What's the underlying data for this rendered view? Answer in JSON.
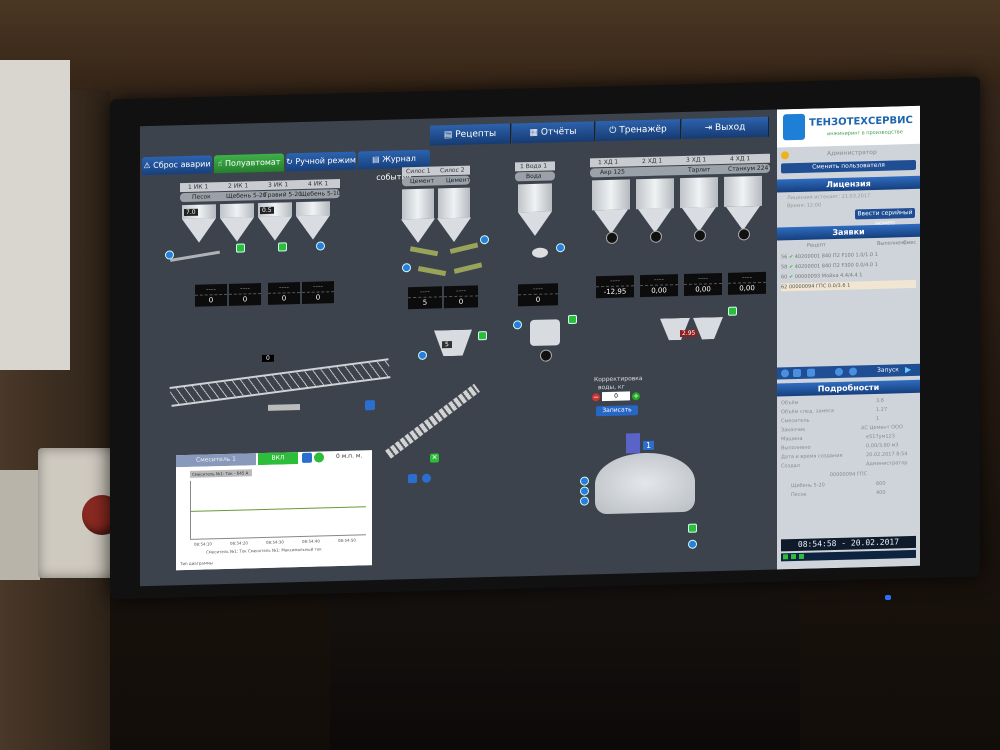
{
  "toolbar": {
    "recipes": "Рецепты",
    "reports": "Отчёты",
    "trainer": "Тренажёр",
    "exit": "Выход"
  },
  "tabs": {
    "alarm_reset": "Сброс аварии",
    "semi_auto": "Полуавтомат",
    "manual": "Ручной режим",
    "events": "Журнал событий"
  },
  "sidebar": {
    "brand": "ТЕНЗОТЕХСЕРВИС",
    "brand_sub": "инжиниринг в производстве",
    "user": "Администратор",
    "change_user": "Сменить пользователя",
    "license_title": "Лицензия",
    "license_line1": "Лицензия истекает: 21.03.2017",
    "license_line2": "Время: 12:00",
    "license_btn": "Ввести серийный номер",
    "orders_title": "Заявки",
    "orders_cols": [
      "Рецепт",
      "Выполнено",
      "Смес"
    ],
    "orders": [
      {
        "id": "56",
        "recipe": "40200001 840 П2 F100",
        "done": "1.0/1.0",
        "mix": "1"
      },
      {
        "id": "58",
        "recipe": "40200001 840 П2 F300",
        "done": "0.0/4.0",
        "mix": "1"
      },
      {
        "id": "60",
        "recipe": "00000093 Мойка",
        "done": "4.4/4.4",
        "mix": "1"
      },
      {
        "id": "62",
        "recipe": "00000094 ГПС",
        "done": "0.0/3.6",
        "mix": "1"
      }
    ],
    "start_btn": "Запуск",
    "details_title": "Подробности",
    "details": [
      {
        "k": "Объём",
        "v": "3.6"
      },
      {
        "k": "Объём след. замеса",
        "v": "1.27"
      },
      {
        "k": "Смеситель",
        "v": "1"
      },
      {
        "k": "Заказчик",
        "v": "АС Цемент ООО"
      },
      {
        "k": "Машина",
        "v": "е517ум123"
      },
      {
        "k": "Выполнено",
        "v": "0.00/3.60 м3"
      },
      {
        "k": "Дата и время создания",
        "v": "20.02.2017 8:54"
      },
      {
        "k": "Создал",
        "v": "Администратор"
      }
    ],
    "recipe_code": "00000094 ГПС",
    "components": [
      {
        "k": "Щебень 5-20",
        "v": "600"
      },
      {
        "k": "Песок",
        "v": "400"
      }
    ],
    "clock": "08:54:58 - 20.02.2017"
  },
  "process": {
    "bins": [
      "Песок",
      "Щебень 5-20",
      "Гравий 5-20",
      "Щебень 5-10"
    ],
    "bin_headers": [
      "1 ИК 1",
      "2 ИК 1",
      "3 ИК 1",
      "4 ИК 1"
    ],
    "silos": [
      "Силос 1",
      "Силос 2"
    ],
    "silo_labels": [
      "Цемент",
      "Цемент"
    ],
    "water_header": "1 Вода 1",
    "water_label": "Вода",
    "chem_headers": [
      "1 ХД 1",
      "2 ХД 1",
      "3 ХД 1",
      "4 ХД 1"
    ],
    "chem_labels": [
      "Акр 125",
      "",
      "Тарлит",
      "Станкум 224"
    ],
    "agg_values": [
      "0",
      "0",
      "0",
      "0"
    ],
    "cement_values": [
      "5",
      "0"
    ],
    "water_value": "0",
    "chem_values": [
      "-12,95",
      "0,00",
      "0,00",
      "0,00"
    ],
    "bin_top_value": "7.0",
    "bin3_value": "0.5",
    "conveyor_value": "0",
    "cement_scale": "5",
    "chem_scale": "2.95",
    "mixer_num": "1",
    "correction_title": "Корректировка",
    "correction_sub": "воды, кг",
    "correction_value": "0",
    "write_btn": "Записать"
  },
  "trend": {
    "tab1": "Смеситель 1",
    "tab2": "ВКЛ",
    "tag": "Смеситель №1: Ток - 645 А",
    "legend": "Смеситель №1: Ток   Смеситель №1: Максимальный ток",
    "foot": "Тип диаграммы",
    "units": "0 м.п. м.",
    "times": [
      "08:54:10",
      "08:54:20",
      "08:54:30",
      "08:54:40",
      "08:54:50"
    ]
  }
}
